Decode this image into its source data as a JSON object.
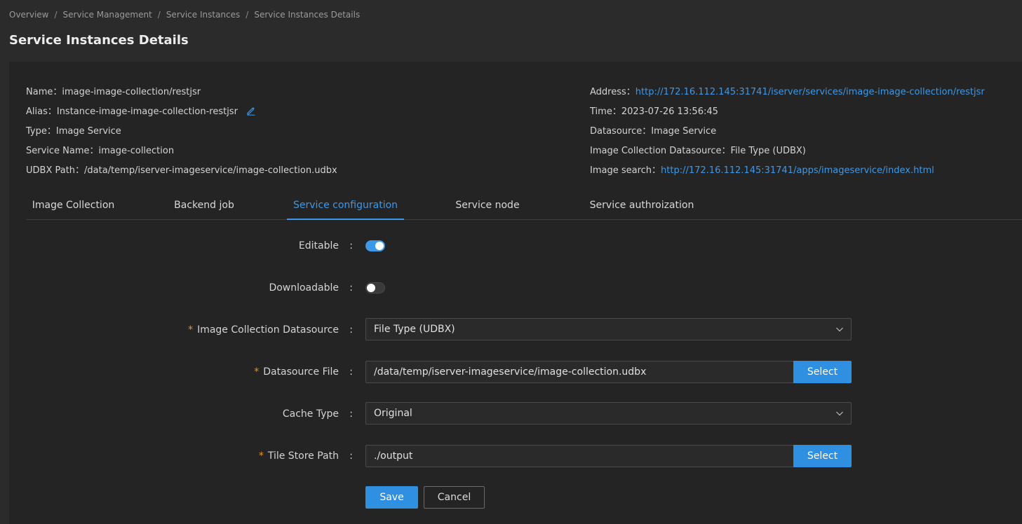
{
  "breadcrumb": {
    "items": [
      "Overview",
      "Service Management",
      "Service Instances",
      "Service Instances Details"
    ],
    "separator": "/"
  },
  "page_title": "Service Instances Details",
  "info": {
    "left": [
      {
        "label": "Name：",
        "value": "image-image-collection/restjsr"
      },
      {
        "label": "Alias：",
        "value": "Instance-image-image-collection-restjsr"
      },
      {
        "label": "Type：",
        "value": "Image Service"
      },
      {
        "label": "Service Name：",
        "value": "image-collection"
      },
      {
        "label": "UDBX Path：",
        "value": "/data/temp/iserver-imageservice/image-collection.udbx"
      }
    ],
    "right": [
      {
        "label": "Address：",
        "value": "http://172.16.112.145:31741/iserver/services/image-image-collection/restjsr"
      },
      {
        "label": "Time：",
        "value": "2023-07-26 13:56:45"
      },
      {
        "label": "Datasource：",
        "value": "Image Service"
      },
      {
        "label": "Image Collection Datasource：",
        "value": "File Type (UDBX)"
      },
      {
        "label": "Image search：",
        "value": "http://172.16.112.145:31741/apps/imageservice/index.html"
      }
    ]
  },
  "tabs": [
    {
      "label": "Image Collection"
    },
    {
      "label": "Backend job"
    },
    {
      "label": "Service configuration",
      "active": true
    },
    {
      "label": "Service node"
    },
    {
      "label": "Service authroization"
    }
  ],
  "form": {
    "colon": ":",
    "required_mark": "*",
    "editable": {
      "label": "Editable",
      "on": true
    },
    "downloadable": {
      "label": "Downloadable",
      "on": false
    },
    "image_collection_datasource": {
      "label": "Image Collection Datasource",
      "value": "File Type (UDBX)"
    },
    "datasource_file": {
      "label": "Datasource File",
      "value": "/data/temp/iserver-imageservice/image-collection.udbx",
      "button": "Select"
    },
    "cache_type": {
      "label": "Cache Type",
      "value": "Original"
    },
    "tile_store_path": {
      "label": "Tile Store Path",
      "value": "./output",
      "button": "Select"
    },
    "save_label": "Save",
    "cancel_label": "Cancel"
  },
  "colors": {
    "accent": "#3d98e8",
    "required": "#e7932d",
    "background": "#2b2b2b",
    "panel": "#242424"
  },
  "icons": {
    "alias_edit": "pencil-icon",
    "select_arrow": "chevron-down-icon"
  }
}
